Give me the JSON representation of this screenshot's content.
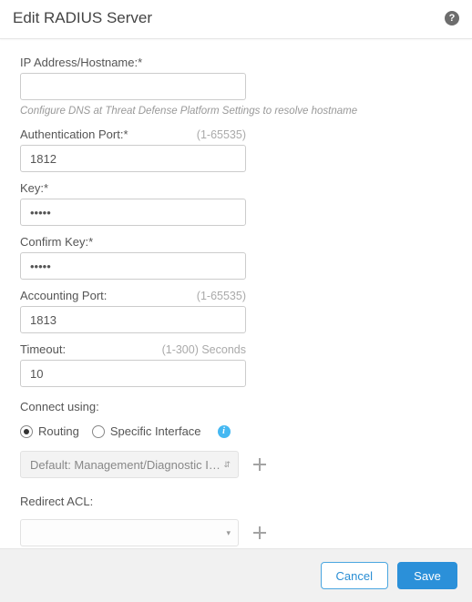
{
  "header": {
    "title": "Edit RADIUS Server",
    "help_glyph": "?"
  },
  "form": {
    "ip": {
      "label": "IP Address/Hostname:*",
      "value": "",
      "help": "Configure DNS at Threat Defense Platform Settings to resolve hostname"
    },
    "auth_port": {
      "label": "Authentication Port:*",
      "hint": "(1-65535)",
      "value": "1812"
    },
    "key": {
      "label": "Key:*",
      "value": "•••••"
    },
    "confirm_key": {
      "label": "Confirm Key:*",
      "value": "•••••"
    },
    "acct_port": {
      "label": "Accounting Port:",
      "hint": "(1-65535)",
      "value": "1813"
    },
    "timeout": {
      "label": "Timeout:",
      "hint": "(1-300) Seconds",
      "value": "10"
    },
    "connect": {
      "label": "Connect using:",
      "options": {
        "routing": "Routing",
        "specific": "Specific Interface"
      },
      "selected": "routing",
      "interface_dd": "Default: Management/Diagnostic Interface"
    },
    "redirect_acl": {
      "label": "Redirect ACL:",
      "value": ""
    }
  },
  "footer": {
    "cancel": "Cancel",
    "save": "Save"
  }
}
